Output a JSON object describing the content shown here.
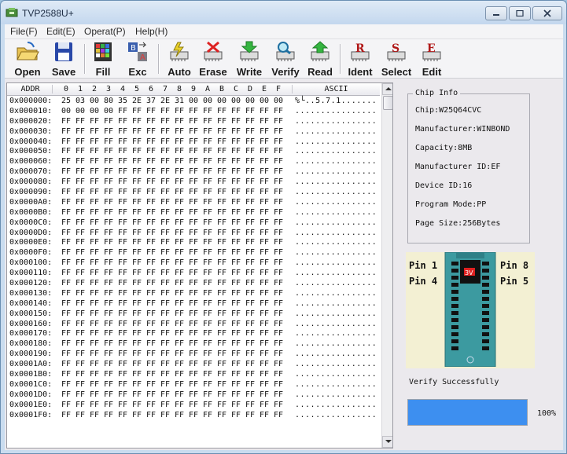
{
  "window": {
    "title": "TVP2588U+"
  },
  "menu": [
    "File(F)",
    "Edit(E)",
    "Operat(P)",
    "Help(H)"
  ],
  "toolbar": [
    {
      "label": "Open",
      "icon": "folder-open-icon"
    },
    {
      "label": "Save",
      "icon": "floppy-disk-icon"
    },
    {
      "label": "Fill",
      "icon": "fill-grid-icon"
    },
    {
      "label": "Exc",
      "icon": "exchange-icon"
    },
    {
      "label": "Auto",
      "icon": "auto-chip-icon"
    },
    {
      "label": "Erase",
      "icon": "erase-chip-icon"
    },
    {
      "label": "Write",
      "icon": "write-chip-icon"
    },
    {
      "label": "Verify",
      "icon": "verify-chip-icon"
    },
    {
      "label": "Read",
      "icon": "read-chip-icon"
    },
    {
      "label": "Ident",
      "icon": "ident-chip-icon"
    },
    {
      "label": "Select",
      "icon": "select-chip-icon"
    },
    {
      "label": "Edit",
      "icon": "edit-chip-icon"
    }
  ],
  "hex": {
    "addr_header": "ADDR",
    "col_headers": [
      "0",
      "1",
      "2",
      "3",
      "4",
      "5",
      "6",
      "7",
      "8",
      "9",
      "A",
      "B",
      "C",
      "D",
      "E",
      "F"
    ],
    "ascii_header": "ASCII",
    "rows": [
      {
        "addr": "0x000000:",
        "bytes": [
          "25",
          "03",
          "00",
          "80",
          "35",
          "2E",
          "37",
          "2E",
          "31",
          "00",
          "00",
          "00",
          "00",
          "00",
          "00",
          "00"
        ],
        "ascii": "%└..5.7.1......."
      },
      {
        "addr": "0x000010:",
        "bytes": [
          "00",
          "00",
          "00",
          "00",
          "FF",
          "FF",
          "FF",
          "FF",
          "FF",
          "FF",
          "FF",
          "FF",
          "FF",
          "FF",
          "FF",
          "FF"
        ],
        "ascii": "................"
      },
      {
        "addr": "0x000020:",
        "bytes": [
          "FF",
          "FF",
          "FF",
          "FF",
          "FF",
          "FF",
          "FF",
          "FF",
          "FF",
          "FF",
          "FF",
          "FF",
          "FF",
          "FF",
          "FF",
          "FF"
        ],
        "ascii": "................"
      },
      {
        "addr": "0x000030:",
        "bytes": [
          "FF",
          "FF",
          "FF",
          "FF",
          "FF",
          "FF",
          "FF",
          "FF",
          "FF",
          "FF",
          "FF",
          "FF",
          "FF",
          "FF",
          "FF",
          "FF"
        ],
        "ascii": "................"
      },
      {
        "addr": "0x000040:",
        "bytes": [
          "FF",
          "FF",
          "FF",
          "FF",
          "FF",
          "FF",
          "FF",
          "FF",
          "FF",
          "FF",
          "FF",
          "FF",
          "FF",
          "FF",
          "FF",
          "FF"
        ],
        "ascii": "................"
      },
      {
        "addr": "0x000050:",
        "bytes": [
          "FF",
          "FF",
          "FF",
          "FF",
          "FF",
          "FF",
          "FF",
          "FF",
          "FF",
          "FF",
          "FF",
          "FF",
          "FF",
          "FF",
          "FF",
          "FF"
        ],
        "ascii": "................"
      },
      {
        "addr": "0x000060:",
        "bytes": [
          "FF",
          "FF",
          "FF",
          "FF",
          "FF",
          "FF",
          "FF",
          "FF",
          "FF",
          "FF",
          "FF",
          "FF",
          "FF",
          "FF",
          "FF",
          "FF"
        ],
        "ascii": "................"
      },
      {
        "addr": "0x000070:",
        "bytes": [
          "FF",
          "FF",
          "FF",
          "FF",
          "FF",
          "FF",
          "FF",
          "FF",
          "FF",
          "FF",
          "FF",
          "FF",
          "FF",
          "FF",
          "FF",
          "FF"
        ],
        "ascii": "................"
      },
      {
        "addr": "0x000080:",
        "bytes": [
          "FF",
          "FF",
          "FF",
          "FF",
          "FF",
          "FF",
          "FF",
          "FF",
          "FF",
          "FF",
          "FF",
          "FF",
          "FF",
          "FF",
          "FF",
          "FF"
        ],
        "ascii": "................"
      },
      {
        "addr": "0x000090:",
        "bytes": [
          "FF",
          "FF",
          "FF",
          "FF",
          "FF",
          "FF",
          "FF",
          "FF",
          "FF",
          "FF",
          "FF",
          "FF",
          "FF",
          "FF",
          "FF",
          "FF"
        ],
        "ascii": "................"
      },
      {
        "addr": "0x0000A0:",
        "bytes": [
          "FF",
          "FF",
          "FF",
          "FF",
          "FF",
          "FF",
          "FF",
          "FF",
          "FF",
          "FF",
          "FF",
          "FF",
          "FF",
          "FF",
          "FF",
          "FF"
        ],
        "ascii": "................"
      },
      {
        "addr": "0x0000B0:",
        "bytes": [
          "FF",
          "FF",
          "FF",
          "FF",
          "FF",
          "FF",
          "FF",
          "FF",
          "FF",
          "FF",
          "FF",
          "FF",
          "FF",
          "FF",
          "FF",
          "FF"
        ],
        "ascii": "................"
      },
      {
        "addr": "0x0000C0:",
        "bytes": [
          "FF",
          "FF",
          "FF",
          "FF",
          "FF",
          "FF",
          "FF",
          "FF",
          "FF",
          "FF",
          "FF",
          "FF",
          "FF",
          "FF",
          "FF",
          "FF"
        ],
        "ascii": "................"
      },
      {
        "addr": "0x0000D0:",
        "bytes": [
          "FF",
          "FF",
          "FF",
          "FF",
          "FF",
          "FF",
          "FF",
          "FF",
          "FF",
          "FF",
          "FF",
          "FF",
          "FF",
          "FF",
          "FF",
          "FF"
        ],
        "ascii": "................"
      },
      {
        "addr": "0x0000E0:",
        "bytes": [
          "FF",
          "FF",
          "FF",
          "FF",
          "FF",
          "FF",
          "FF",
          "FF",
          "FF",
          "FF",
          "FF",
          "FF",
          "FF",
          "FF",
          "FF",
          "FF"
        ],
        "ascii": "................"
      },
      {
        "addr": "0x0000F0:",
        "bytes": [
          "FF",
          "FF",
          "FF",
          "FF",
          "FF",
          "FF",
          "FF",
          "FF",
          "FF",
          "FF",
          "FF",
          "FF",
          "FF",
          "FF",
          "FF",
          "FF"
        ],
        "ascii": "................"
      },
      {
        "addr": "0x000100:",
        "bytes": [
          "FF",
          "FF",
          "FF",
          "FF",
          "FF",
          "FF",
          "FF",
          "FF",
          "FF",
          "FF",
          "FF",
          "FF",
          "FF",
          "FF",
          "FF",
          "FF"
        ],
        "ascii": "................"
      },
      {
        "addr": "0x000110:",
        "bytes": [
          "FF",
          "FF",
          "FF",
          "FF",
          "FF",
          "FF",
          "FF",
          "FF",
          "FF",
          "FF",
          "FF",
          "FF",
          "FF",
          "FF",
          "FF",
          "FF"
        ],
        "ascii": "................"
      },
      {
        "addr": "0x000120:",
        "bytes": [
          "FF",
          "FF",
          "FF",
          "FF",
          "FF",
          "FF",
          "FF",
          "FF",
          "FF",
          "FF",
          "FF",
          "FF",
          "FF",
          "FF",
          "FF",
          "FF"
        ],
        "ascii": "................"
      },
      {
        "addr": "0x000130:",
        "bytes": [
          "FF",
          "FF",
          "FF",
          "FF",
          "FF",
          "FF",
          "FF",
          "FF",
          "FF",
          "FF",
          "FF",
          "FF",
          "FF",
          "FF",
          "FF",
          "FF"
        ],
        "ascii": "................"
      },
      {
        "addr": "0x000140:",
        "bytes": [
          "FF",
          "FF",
          "FF",
          "FF",
          "FF",
          "FF",
          "FF",
          "FF",
          "FF",
          "FF",
          "FF",
          "FF",
          "FF",
          "FF",
          "FF",
          "FF"
        ],
        "ascii": "................"
      },
      {
        "addr": "0x000150:",
        "bytes": [
          "FF",
          "FF",
          "FF",
          "FF",
          "FF",
          "FF",
          "FF",
          "FF",
          "FF",
          "FF",
          "FF",
          "FF",
          "FF",
          "FF",
          "FF",
          "FF"
        ],
        "ascii": "................"
      },
      {
        "addr": "0x000160:",
        "bytes": [
          "FF",
          "FF",
          "FF",
          "FF",
          "FF",
          "FF",
          "FF",
          "FF",
          "FF",
          "FF",
          "FF",
          "FF",
          "FF",
          "FF",
          "FF",
          "FF"
        ],
        "ascii": "................"
      },
      {
        "addr": "0x000170:",
        "bytes": [
          "FF",
          "FF",
          "FF",
          "FF",
          "FF",
          "FF",
          "FF",
          "FF",
          "FF",
          "FF",
          "FF",
          "FF",
          "FF",
          "FF",
          "FF",
          "FF"
        ],
        "ascii": "................"
      },
      {
        "addr": "0x000180:",
        "bytes": [
          "FF",
          "FF",
          "FF",
          "FF",
          "FF",
          "FF",
          "FF",
          "FF",
          "FF",
          "FF",
          "FF",
          "FF",
          "FF",
          "FF",
          "FF",
          "FF"
        ],
        "ascii": "................"
      },
      {
        "addr": "0x000190:",
        "bytes": [
          "FF",
          "FF",
          "FF",
          "FF",
          "FF",
          "FF",
          "FF",
          "FF",
          "FF",
          "FF",
          "FF",
          "FF",
          "FF",
          "FF",
          "FF",
          "FF"
        ],
        "ascii": "................"
      },
      {
        "addr": "0x0001A0:",
        "bytes": [
          "FF",
          "FF",
          "FF",
          "FF",
          "FF",
          "FF",
          "FF",
          "FF",
          "FF",
          "FF",
          "FF",
          "FF",
          "FF",
          "FF",
          "FF",
          "FF"
        ],
        "ascii": "................"
      },
      {
        "addr": "0x0001B0:",
        "bytes": [
          "FF",
          "FF",
          "FF",
          "FF",
          "FF",
          "FF",
          "FF",
          "FF",
          "FF",
          "FF",
          "FF",
          "FF",
          "FF",
          "FF",
          "FF",
          "FF"
        ],
        "ascii": "................"
      },
      {
        "addr": "0x0001C0:",
        "bytes": [
          "FF",
          "FF",
          "FF",
          "FF",
          "FF",
          "FF",
          "FF",
          "FF",
          "FF",
          "FF",
          "FF",
          "FF",
          "FF",
          "FF",
          "FF",
          "FF"
        ],
        "ascii": "................"
      },
      {
        "addr": "0x0001D0:",
        "bytes": [
          "FF",
          "FF",
          "FF",
          "FF",
          "FF",
          "FF",
          "FF",
          "FF",
          "FF",
          "FF",
          "FF",
          "FF",
          "FF",
          "FF",
          "FF",
          "FF"
        ],
        "ascii": "................"
      },
      {
        "addr": "0x0001E0:",
        "bytes": [
          "FF",
          "FF",
          "FF",
          "FF",
          "FF",
          "FF",
          "FF",
          "FF",
          "FF",
          "FF",
          "FF",
          "FF",
          "FF",
          "FF",
          "FF",
          "FF"
        ],
        "ascii": "................"
      },
      {
        "addr": "0x0001F0:",
        "bytes": [
          "FF",
          "FF",
          "FF",
          "FF",
          "FF",
          "FF",
          "FF",
          "FF",
          "FF",
          "FF",
          "FF",
          "FF",
          "FF",
          "FF",
          "FF",
          "FF"
        ],
        "ascii": "................"
      }
    ]
  },
  "chip_info": {
    "title": "Chip Info",
    "lines": [
      "Chip:W25Q64CVC",
      "Manufacturer:WINBOND",
      "Capacity:8MB",
      "Manufacturer ID:EF",
      "Device ID:16",
      "Program Mode:PP",
      "Page Size:256Bytes"
    ]
  },
  "socket": {
    "pin1": "Pin 1",
    "pin4": "Pin 4",
    "pin8": "Pin 8",
    "pin5": "Pin 5",
    "chip_mark": "3V",
    "colors": {
      "socket": "#3c9aa0",
      "board": "#f3f0d3",
      "chip": "#111111",
      "mark": "#e02020"
    }
  },
  "status": {
    "message": "Verify Successfully",
    "progress": 100,
    "progress_text": "100%",
    "progress_color": "#3d8ff0"
  }
}
